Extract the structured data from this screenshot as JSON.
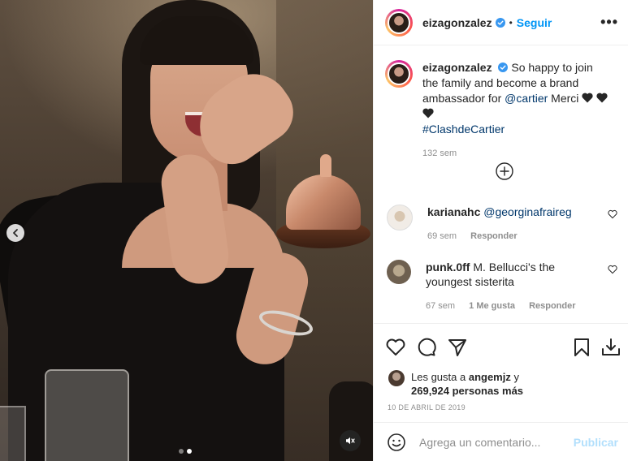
{
  "post": {
    "username": "eizagonzalez",
    "follow_label": "Seguir",
    "separator": "•",
    "more_label": "•••"
  },
  "caption": {
    "username": "eizagonzalez",
    "text_before": "So happy to join the family and become a brand ambassador for",
    "mention": "@cartier",
    "text_after": "Merci",
    "hashtag": "#ClashdeCartier",
    "hearts": [
      "black-heart-icon",
      "black-heart-icon",
      "black-heart-icon"
    ],
    "age": "132 sem"
  },
  "comments": [
    {
      "username": "karianahc",
      "text": "@georginafraireg",
      "age": "69 sem",
      "likes_label": "",
      "reply_label": "Responder"
    },
    {
      "username": "punk.0ff",
      "text": "M. Bellucci's the youngest sisterita",
      "age": "67 sem",
      "likes_label": "1 Me gusta",
      "reply_label": "Responder"
    }
  ],
  "likes": {
    "prefix": "Les gusta a",
    "user": "angemjz",
    "connector": "y",
    "count": "269,924 personas más"
  },
  "date": "10 DE ABRIL DE 2019",
  "comment_box": {
    "placeholder": "Agrega un comentario...",
    "publish_label": "Publicar"
  },
  "carousel": {
    "current": 2,
    "total": 2
  },
  "colors": {
    "link": "#00376b",
    "follow": "#0095f6",
    "publish_disabled": "#b2dffc",
    "muted": "#8e8e8e"
  }
}
